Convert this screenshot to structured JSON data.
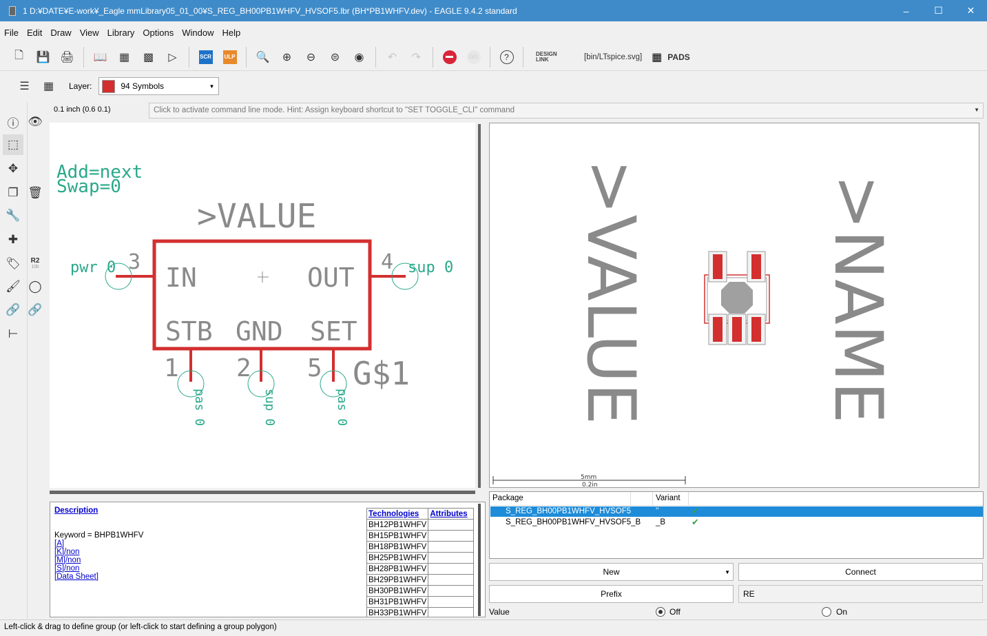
{
  "window": {
    "title": "1 D:¥DATE¥E-work¥_Eagle mmLibrary05_01_00¥S_REG_BH00PB1WHFV_HVSOF5.lbr (BH*PB1WHFV.dev) - EAGLE 9.4.2 standard"
  },
  "menu": [
    "File",
    "Edit",
    "Draw",
    "View",
    "Library",
    "Options",
    "Window",
    "Help"
  ],
  "toolbar": {
    "scr_label": "SCR",
    "ulp_label": "ULP",
    "go_label": "GO",
    "help_label": "?",
    "design_link_label": "DESIGN LINK",
    "script_label": "[bin/LTspice.svg]",
    "pads_label": "PADS"
  },
  "layerbar": {
    "label": "Layer:",
    "selected": "94 Symbols",
    "swatch_color": "#d32f2f"
  },
  "grid_info": "0.1 inch (0.6 0.1)",
  "command_line": {
    "placeholder": "Click to activate command line mode. Hint: Assign keyboard shortcut to \"SET TOGGLE_CLI\" command"
  },
  "lefttools": {
    "r2_label": "R2",
    "r2_value": "10k"
  },
  "symbol": {
    "add_text": "Add=next",
    "swap_text": "Swap=0",
    "value_text": ">VALUE",
    "gate_name": "G$1",
    "pin_in": "IN",
    "pin_out": "OUT",
    "pin_stb": "STB",
    "pin_gnd": "GND",
    "pin_set": "SET",
    "num_3": "3",
    "num_4": "4",
    "num_1": "1",
    "num_2": "2",
    "num_5": "5",
    "pwr_label": "pwr 0",
    "sup_label": "sup 0",
    "pas1_label": "pas 0",
    "sup2_label": "sup 0",
    "pas5_label": "pas 0",
    "symbol_color": "#d32f2f",
    "pin_text_color": "#2aa88a",
    "text_color": "#8a8a8a"
  },
  "package_preview": {
    "value_text": ">VALUE",
    "name_text": ">NAME",
    "scale_mm": "5mm",
    "scale_in": "0.2in"
  },
  "description": {
    "title": "Description",
    "keyword": "Keyword = BHPB1WHFV",
    "links": [
      "[A]",
      "[K]/non",
      "[M]/non",
      "[S]/non",
      "[Data Sheet]"
    ]
  },
  "technologies": {
    "header_tech": "Technologies",
    "header_attr": "Attributes",
    "rows": [
      "BH12PB1WHFV",
      "BH15PB1WHFV",
      "BH18PB1WHFV",
      "BH25PB1WHFV",
      "BH28PB1WHFV",
      "BH29PB1WHFV",
      "BH30PB1WHFV",
      "BH31PB1WHFV",
      "BH33PB1WHFV"
    ]
  },
  "packages": {
    "header_package": "Package",
    "header_variant": "Variant",
    "rows": [
      {
        "name": "S_REG_BH00PB1WHFV_HVSOF5",
        "variant": "''",
        "selected": true
      },
      {
        "name": "S_REG_BH00PB1WHFV_HVSOF5_B",
        "variant": "_B",
        "selected": false
      }
    ]
  },
  "buttons": {
    "new": "New",
    "connect": "Connect",
    "prefix": "Prefix",
    "prefix_value": "RE"
  },
  "value_option": {
    "label": "Value",
    "off": "Off",
    "on": "On",
    "selected": "Off"
  },
  "status": "Left-click & drag to define group (or left-click to start defining a group polygon)"
}
